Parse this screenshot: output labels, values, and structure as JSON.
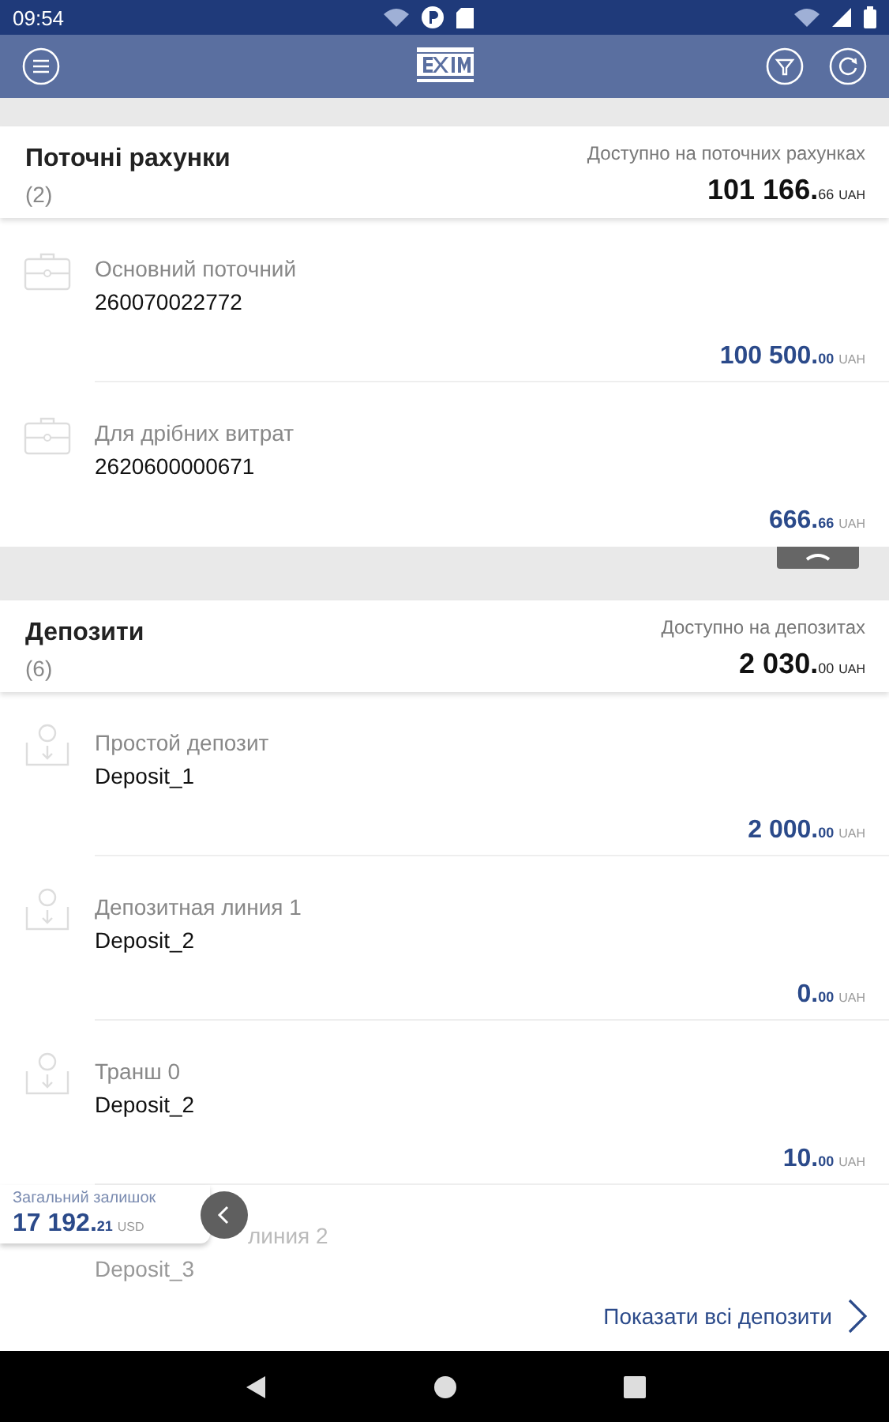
{
  "status_bar": {
    "time": "09:54"
  },
  "sections": [
    {
      "title": "Поточні рахунки",
      "count": "(2)",
      "total_label": "Доступно на поточних рахунках",
      "total": {
        "whole": "101 166.",
        "cents": "66",
        "currency": "UAH"
      },
      "items": [
        {
          "kind": "account",
          "name": "Основний поточний",
          "number": "260070022772",
          "amount": {
            "whole": "100 500.",
            "cents": "00",
            "currency": "UAH"
          }
        },
        {
          "kind": "account",
          "name": "Для дрібних витрат",
          "number": "2620600000671",
          "amount": {
            "whole": "666.",
            "cents": "66",
            "currency": "UAH"
          }
        }
      ]
    },
    {
      "title": "Депозити",
      "count": "(6)",
      "total_label": "Доступно на депозитах",
      "total": {
        "whole": "2 030.",
        "cents": "00",
        "currency": "UAH"
      },
      "items": [
        {
          "kind": "deposit",
          "name": "Простой депозит",
          "number": "Deposit_1",
          "amount": {
            "whole": "2 000.",
            "cents": "00",
            "currency": "UAH"
          }
        },
        {
          "kind": "deposit",
          "name": "Депозитная линия 1",
          "number": "Deposit_2",
          "amount": {
            "whole": "0.",
            "cents": "00",
            "currency": "UAH"
          }
        },
        {
          "kind": "deposit",
          "name": "Транш 0",
          "number": "Deposit_2",
          "amount": {
            "whole": "10.",
            "cents": "00",
            "currency": "UAH"
          }
        },
        {
          "kind": "partial",
          "name": "линия 2",
          "number": "Deposit_3"
        }
      ]
    }
  ],
  "show_all": {
    "label": "Показати всі депозити"
  },
  "balance": {
    "label": "Загальний залишок",
    "whole": "17 192.",
    "cents": "21",
    "currency": "USD"
  }
}
